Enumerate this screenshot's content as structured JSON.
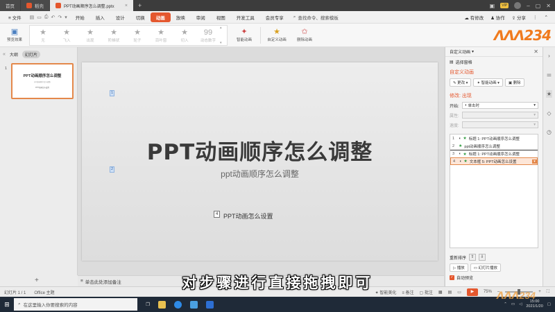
{
  "titlebar": {
    "tabs": [
      {
        "label": "首页"
      },
      {
        "label": "稻壳"
      },
      {
        "label": "PPT动画顺序怎么调整.pptx"
      }
    ],
    "right_status": "有修改",
    "collab": "协作",
    "share": "分享"
  },
  "menu": {
    "file": "文件",
    "items": [
      "开始",
      "插入",
      "设计",
      "切换",
      "动画",
      "放映",
      "审阅",
      "视图",
      "开发工具",
      "会员专享"
    ],
    "active": "动画",
    "search": "查找命令、搜索模板"
  },
  "ribbon": {
    "preview": "预览效果",
    "effects": [
      "无",
      "飞入",
      "出现",
      "阶梯状",
      "轮子",
      "百叶窗",
      "切入",
      "动态数字"
    ],
    "smart": "智能动画",
    "custom": "自定义动画",
    "delete": "删除动画",
    "logo": "ᐱᐱᐱ234"
  },
  "leftpane": {
    "tabs": [
      "大纲",
      "幻灯片"
    ],
    "active_tab": "幻灯片",
    "thumb_number": "1",
    "thumb_title": "PPT动画顺序怎么调整",
    "thumb_sub": "ppt动画顺序怎么调整",
    "thumb_note": "PPT动画怎么设置"
  },
  "slide": {
    "title": "PPT动画顺序怎么调整",
    "subtitle": "ppt动画顺序怎么调整",
    "note": "PPT动画怎么设置",
    "markers": [
      "1",
      "2",
      "4"
    ]
  },
  "notes_placeholder": "单击此处添加备注",
  "animpane": {
    "title": "自定义动画",
    "select_pane": "选择窗格",
    "section": "自定义动画",
    "change": "更改",
    "smart": "智能动画",
    "delete": "删除",
    "modify": "修改: 出现",
    "start_label": "开始:",
    "start_value": "单击时",
    "prop_label": "属性:",
    "speed_label": "速度:",
    "items": [
      {
        "n": "1",
        "label": "标题 1: PPT动画顺序怎么调整"
      },
      {
        "n": "2",
        "label": "ppt动画顺序怎么调整"
      },
      {
        "n": "3",
        "label": "标题 1: PPT动画顺序怎么调整"
      },
      {
        "n": "4",
        "label": "文本框 5: PPT动画怎么设置"
      }
    ],
    "reorder": "重新排序",
    "play": "播放",
    "slideshow": "幻灯片播放",
    "autopreview": "自动预览"
  },
  "statusbar": {
    "slide": "幻灯片 1 / 1",
    "theme": "Office 主题",
    "beautify": "智能美化",
    "notes": "备注",
    "comment": "批注",
    "zoom": "75%"
  },
  "taskbar": {
    "search": "在这里输入你要搜索的内容",
    "time": "15:00",
    "date": "2021/1/20"
  },
  "caption": "对步骤进行直接拖拽即可",
  "watermark": "ᐱᐱᐱ234"
}
